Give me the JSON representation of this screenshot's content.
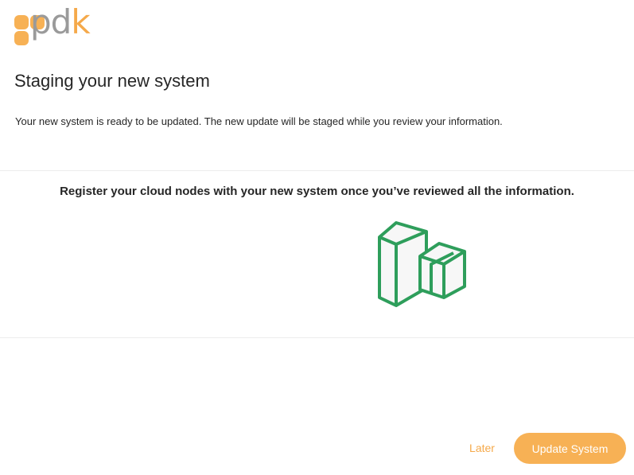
{
  "brand": {
    "logo_text_main": "pd",
    "logo_text_accent": "k",
    "accent_color": "#f7b155",
    "icon_color": "#2e9e5b"
  },
  "header": {
    "title": "Staging your new system",
    "description": "Your new system is ready to be updated. The new update will be staged while you review your information."
  },
  "panel": {
    "heading": "Register your cloud nodes with your new system once you’ve reviewed all the information.",
    "illustration_icon": "cloud-nodes-icon"
  },
  "footer": {
    "later_label": "Later",
    "update_label": "Update System"
  }
}
